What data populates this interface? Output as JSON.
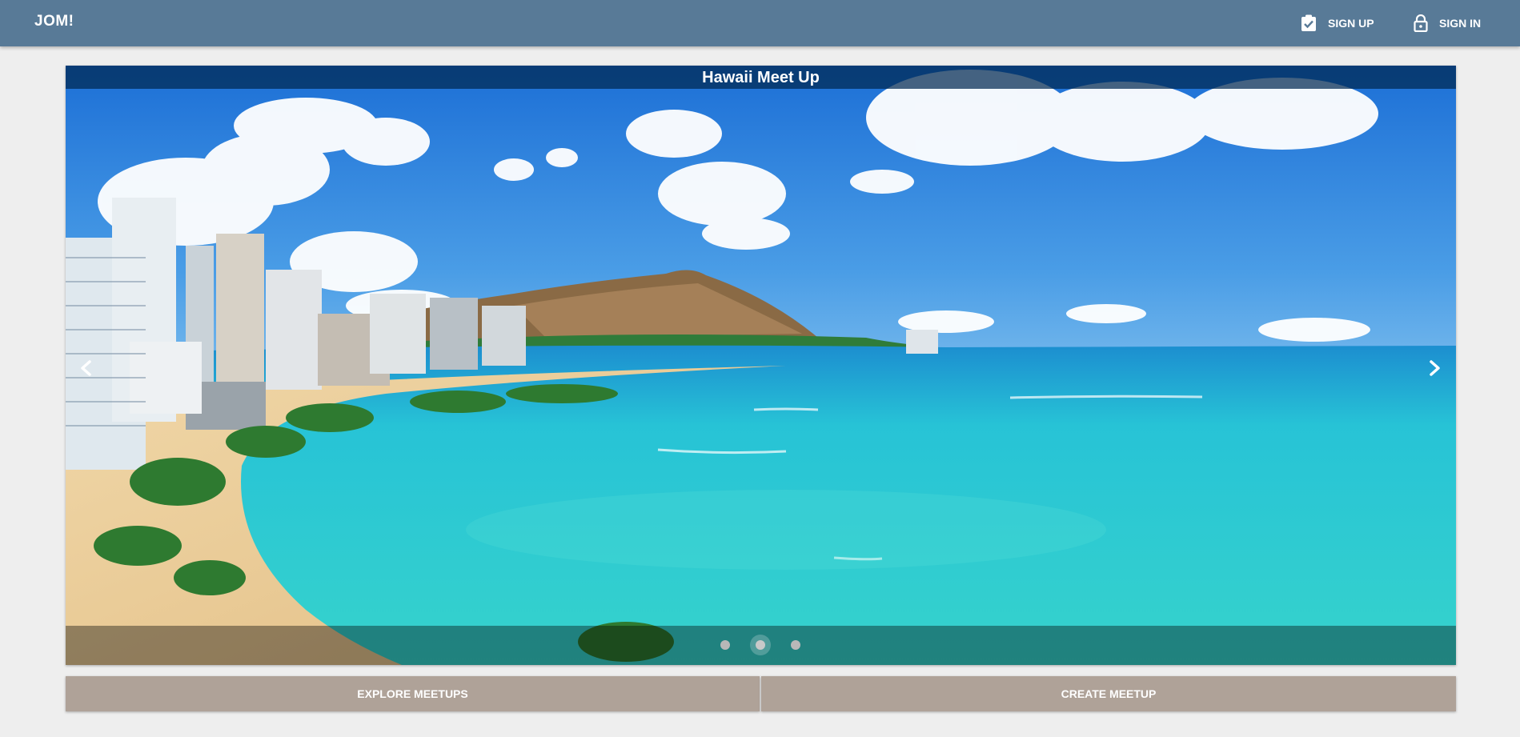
{
  "app": {
    "brand": "JOM!"
  },
  "nav": {
    "signup_label": "SIGN UP",
    "signin_label": "SIGN IN",
    "signup_icon": "clipboard-check-icon",
    "signin_icon": "lock-icon"
  },
  "carousel": {
    "title": "Hawaii Meet Up",
    "slide_count": 3,
    "active_slide": 2,
    "prev_icon": "chevron-left-icon",
    "next_icon": "chevron-right-icon"
  },
  "actions": {
    "explore_label": "EXPLORE MEETUPS",
    "create_label": "CREATE MEETUP"
  },
  "colors": {
    "toolbar": "#587a97",
    "action_button": "#afa298",
    "background": "#eeeeee"
  }
}
